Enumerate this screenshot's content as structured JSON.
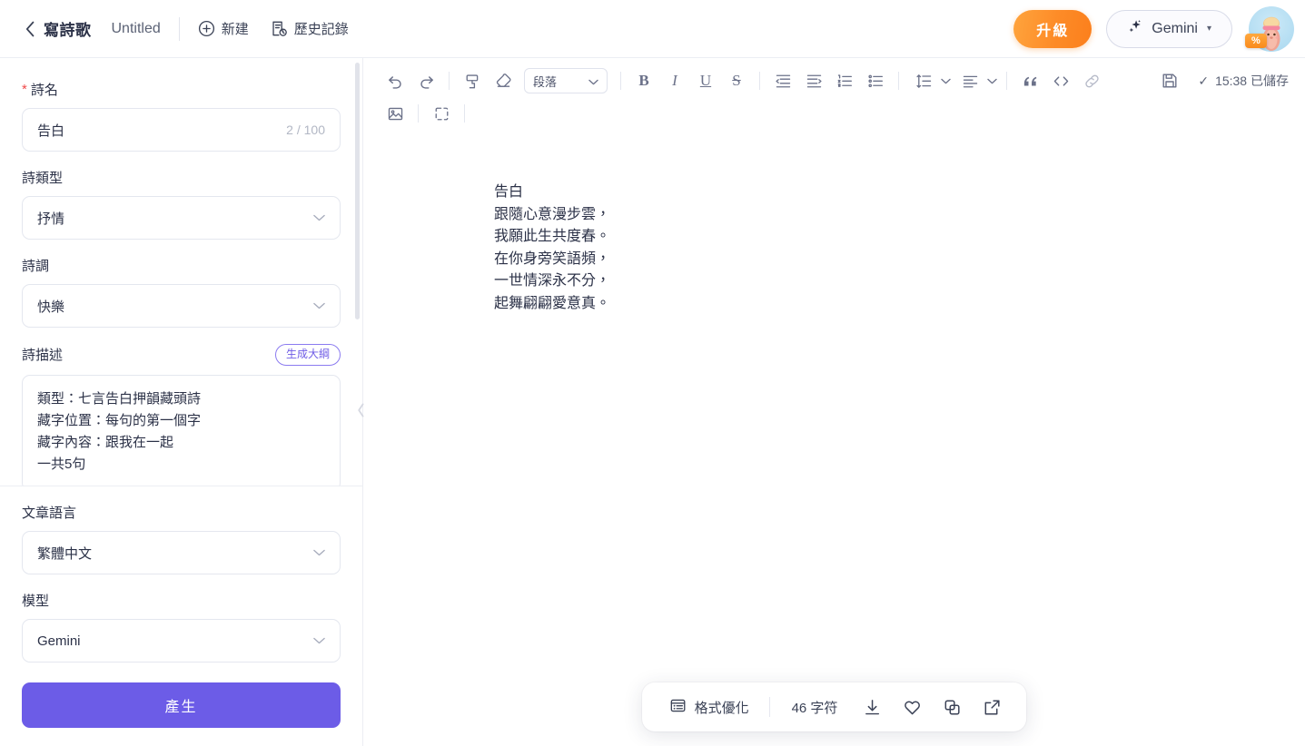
{
  "header": {
    "back_icon": "chevron-left-icon",
    "app_title": "寫詩歌",
    "doc_title": "Untitled",
    "new_label": "新建",
    "history_label": "歷史記錄",
    "upgrade_label": "升級",
    "model_label": "Gemini",
    "model_caret": "▾",
    "avatar_badge": "%",
    "accent_orange": "#fb8b27",
    "accent_purple": "#6c5ce7"
  },
  "sidebar": {
    "title_field": {
      "required_mark": "*",
      "label": "詩名",
      "value": "告白",
      "counter": "2 / 100"
    },
    "type_field": {
      "label": "詩類型",
      "value": "抒情"
    },
    "tone_field": {
      "label": "詩調",
      "value": "快樂"
    },
    "desc_field": {
      "label": "詩描述",
      "outline_badge": "生成大綱",
      "value": "類型：七言告白押韻藏頭詩\n藏字位置：每句的第一個字\n藏字內容：跟我在一起\n一共5句"
    },
    "language_field": {
      "label": "文章語言",
      "value": "繁體中文"
    },
    "model_field": {
      "label": "模型",
      "value": "Gemini"
    },
    "generate_label": "產生",
    "collapse_icon": "chevron-left-icon"
  },
  "toolbar": {
    "undo": "undo-icon",
    "redo": "redo-icon",
    "format_painter": "format-painter-icon",
    "clear_format": "eraser-icon",
    "block_type": "段落",
    "bold": "B",
    "italic": "I",
    "underline": "U",
    "strike": "S",
    "outdent": "outdent-icon",
    "indent": "indent-icon",
    "ordered_list": "ordered-list-icon",
    "bullet_list": "bullet-list-icon",
    "line_height": "line-height-icon",
    "align": "align-icon",
    "quote": "quote-icon",
    "code": "code-icon",
    "link": "link-icon",
    "save": "save-icon",
    "save_status": "15:38 已儲存",
    "save_check": "✓",
    "image": "image-icon",
    "fullscreen": "fullscreen-icon"
  },
  "editor": {
    "content": "告白\n跟隨心意漫步雲，\n我願此生共度春。\n在你身旁笑語頻，\n一世情深永不分，\n起舞翩翩愛意真。"
  },
  "floatbar": {
    "format_label": "格式優化",
    "format_icon": "format-list-icon",
    "char_count": "46 字符",
    "download_icon": "download-icon",
    "favorite_icon": "heart-icon",
    "copy_icon": "copy-icon",
    "share_icon": "external-link-icon"
  }
}
